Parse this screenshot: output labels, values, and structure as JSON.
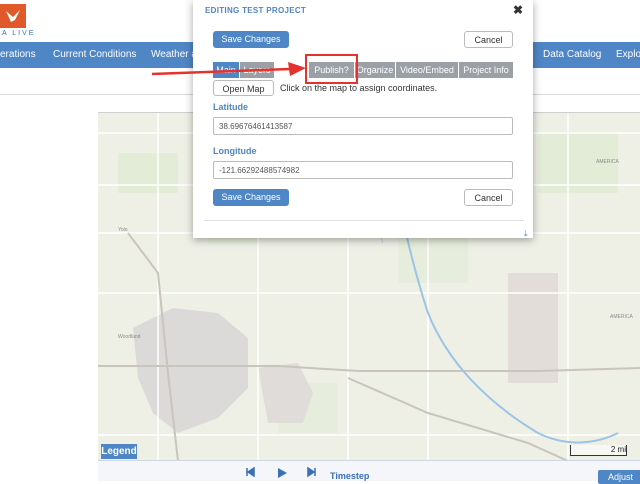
{
  "header": {
    "logo_text": "A LIVE"
  },
  "nav": {
    "items": [
      {
        "label": "erations"
      },
      {
        "label": "Current Conditions"
      },
      {
        "label": "Weather a"
      },
      {
        "label": "Data Catalog"
      },
      {
        "label": "Explor"
      }
    ]
  },
  "dialog": {
    "title": "EDITING TEST PROJECT",
    "close_icon": "close-icon",
    "save_label": "Save Changes",
    "cancel_label": "Cancel",
    "tabs": [
      {
        "label": "Main",
        "active": true
      },
      {
        "label": "Layers",
        "active": false
      },
      {
        "label": "Publish?",
        "active": false
      },
      {
        "label": "Organize",
        "active": false
      },
      {
        "label": "Video/Embed",
        "active": false
      },
      {
        "label": "Project Info",
        "active": false
      }
    ],
    "open_map_label": "Open Map",
    "hint": "Click on the map to assign coordinates.",
    "latitude_label": "Latitude",
    "latitude_value": "38.69676461413587",
    "longitude_label": "Longitude",
    "longitude_value": "-121.66292488574982"
  },
  "map": {
    "legend_label": "Legend",
    "scale_label": "2 mi",
    "place_labels": [
      "Woodland",
      "AMERICA",
      "AMERICA",
      "Yolo"
    ]
  },
  "bottom": {
    "timestep_label": "Timestep",
    "adjust_label": "Adjust"
  },
  "colors": {
    "brand_blue": "#4f86c6",
    "logo_orange": "#e0592a",
    "highlight_red": "#e5322d"
  }
}
